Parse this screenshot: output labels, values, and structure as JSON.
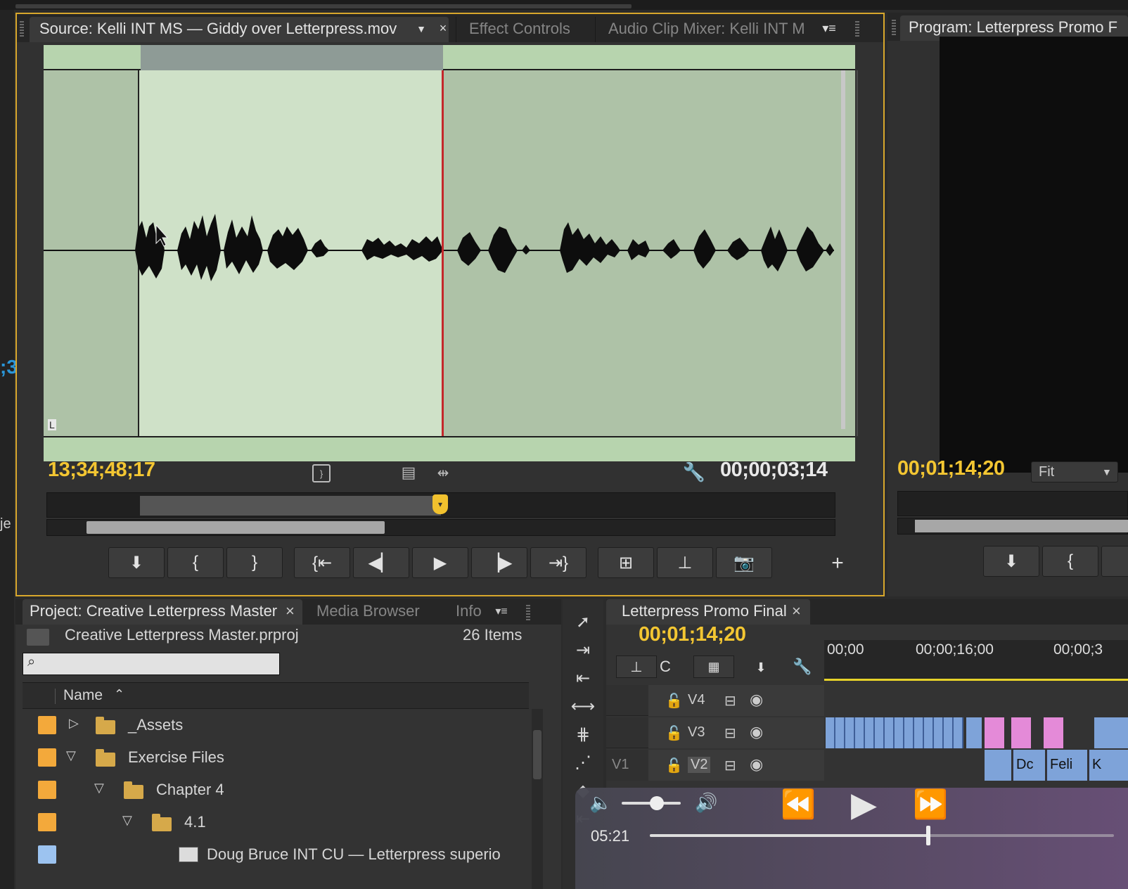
{
  "source_panel": {
    "tabs": [
      "Source: Kelli INT MS — Giddy over Letterpress.mov",
      "Effect Controls",
      "Audio Clip Mixer: Kelli INT M"
    ],
    "channel_label": "L",
    "playhead_timecode": "13;34;48;17",
    "duration_timecode": "00;00;03;14"
  },
  "program_panel": {
    "tab": "Program: Letterpress Promo F",
    "timecode": "00;01;14;20",
    "zoom": "Fit"
  },
  "project_panel": {
    "tabs": [
      "Project: Creative Letterpress Master",
      "Media Browser",
      "Info"
    ],
    "file_name": "Creative Letterpress Master.prproj",
    "item_count": "26 Items",
    "search_placeholder": "",
    "column_name": "Name",
    "rows": [
      {
        "label": "_Assets",
        "color": "#f3a93b"
      },
      {
        "label": "Exercise Files",
        "color": "#f3a93b"
      },
      {
        "label": "Chapter 4",
        "color": "#f3a93b"
      },
      {
        "label": "4.1",
        "color": "#f3a93b"
      },
      {
        "label": "Doug Bruce INT CU — Letterpress superio",
        "color": "#9cc3f0"
      }
    ]
  },
  "timeline_panel": {
    "tab": "Letterpress Promo Final",
    "timecode": "00;01;14;20",
    "ruler": [
      "00;00",
      "00;00;16;00",
      "00;00;3"
    ],
    "tracks": [
      "V4",
      "V3",
      "V2"
    ],
    "source_patch": "V1",
    "clip_labels": [
      "Dc",
      "Feli",
      "K"
    ]
  },
  "left_edge": {
    "fragment_1": ";3",
    "fragment_2": "je"
  },
  "video_player": {
    "elapsed": "05:21",
    "progress": 0.6,
    "volume": 0.6
  }
}
